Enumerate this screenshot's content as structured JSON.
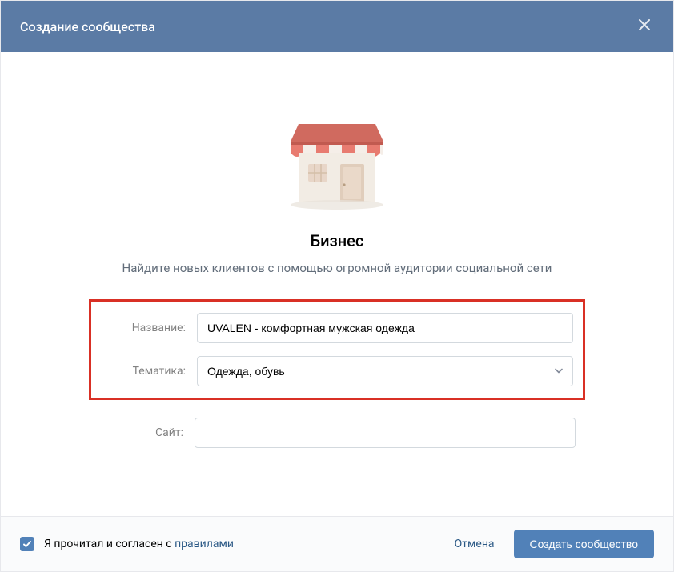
{
  "header": {
    "title": "Создание сообщества"
  },
  "body": {
    "section_title": "Бизнес",
    "section_desc": "Найдите новых клиентов с помощью огромной аудитории социальной сети",
    "labels": {
      "name": "Название:",
      "topic": "Тематика:",
      "site": "Сайт:"
    },
    "values": {
      "name": "UVALEN - комфортная мужская одежда",
      "topic": "Одежда, обувь",
      "site": ""
    }
  },
  "footer": {
    "agree_text": "Я прочитал и согласен с ",
    "agree_link": "правилами",
    "cancel": "Отмена",
    "submit": "Создать сообщество"
  }
}
